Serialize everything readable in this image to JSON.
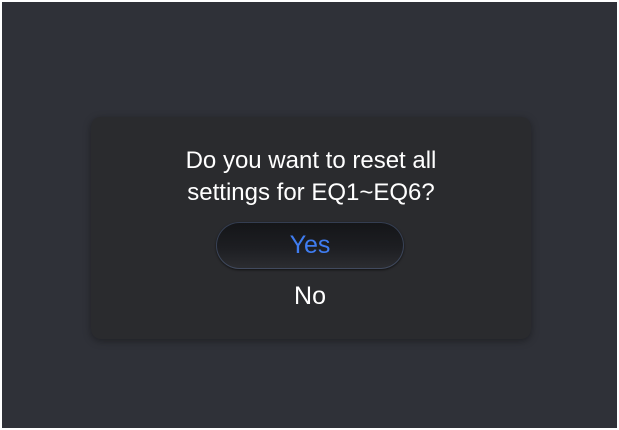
{
  "dialog": {
    "message_line1": "Do you want to reset all",
    "message_line2": "settings for EQ1~EQ6?",
    "yes_label": "Yes",
    "no_label": "No"
  },
  "colors": {
    "screen_background": "#2f3138",
    "dialog_background": "#2a2b2e",
    "accent": "#3f7cf0",
    "text": "#ffffff"
  }
}
